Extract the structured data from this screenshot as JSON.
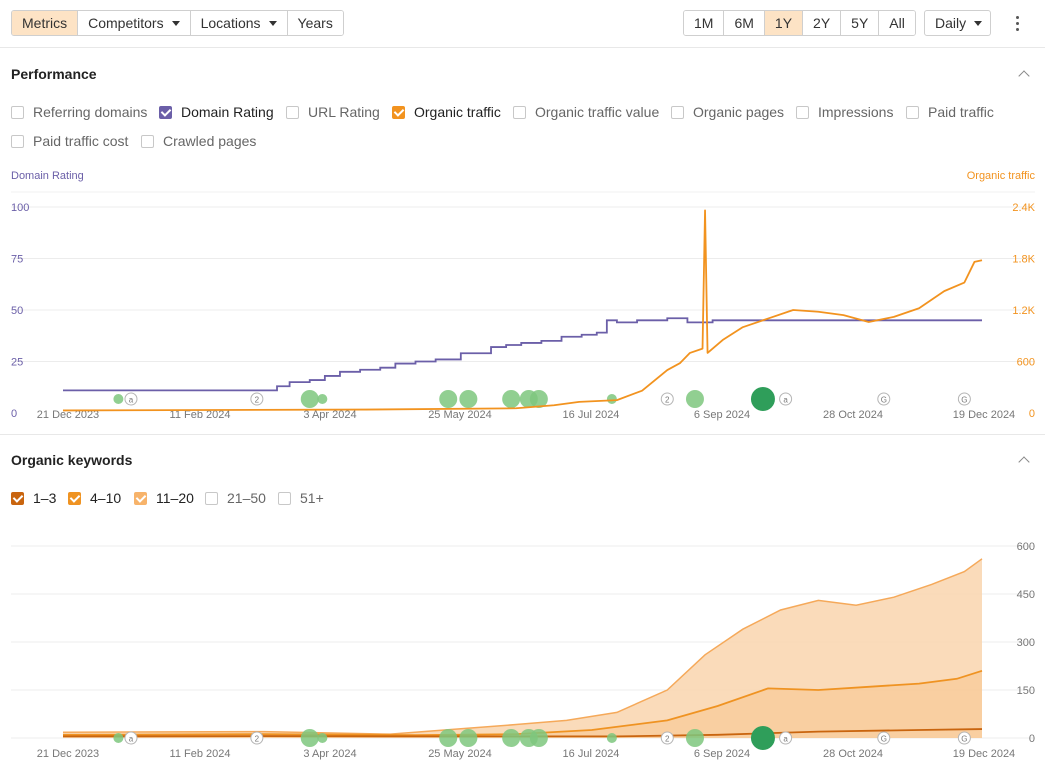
{
  "toolbar": {
    "tabs": [
      {
        "label": "Metrics",
        "active": true
      },
      {
        "label": "Competitors",
        "dropdown": true
      },
      {
        "label": "Locations",
        "dropdown": true
      },
      {
        "label": "Years"
      }
    ],
    "ranges": [
      {
        "label": "1M"
      },
      {
        "label": "6M"
      },
      {
        "label": "1Y",
        "active": true
      },
      {
        "label": "2Y"
      },
      {
        "label": "5Y"
      },
      {
        "label": "All"
      }
    ],
    "granularity": "Daily"
  },
  "performance": {
    "title": "Performance",
    "metrics": [
      {
        "label": "Referring domains",
        "checked": false
      },
      {
        "label": "Domain Rating",
        "checked": true,
        "color": "#6b5fa8"
      },
      {
        "label": "URL Rating",
        "checked": false
      },
      {
        "label": "Organic traffic",
        "checked": true,
        "color": "#f2931f"
      },
      {
        "label": "Organic traffic value",
        "checked": false
      },
      {
        "label": "Organic pages",
        "checked": false
      },
      {
        "label": "Impressions",
        "checked": false
      },
      {
        "label": "Paid traffic",
        "checked": false
      },
      {
        "label": "Paid traffic cost",
        "checked": false
      },
      {
        "label": "Crawled pages",
        "checked": false
      }
    ]
  },
  "keywords": {
    "title": "Organic keywords",
    "buckets": [
      {
        "label": "1–3",
        "checked": true,
        "color": "#c9650f"
      },
      {
        "label": "4–10",
        "checked": true,
        "color": "#ef9322"
      },
      {
        "label": "11–20",
        "checked": true,
        "color": "#f7b36a"
      },
      {
        "label": "21–50",
        "checked": false
      },
      {
        "label": "51+",
        "checked": false
      }
    ]
  },
  "colors": {
    "domain_rating": "#6b5fa8",
    "organic_traffic": "#f2931f",
    "kw_1_3": "#c9650f",
    "kw_4_10": "#ef9322",
    "kw_11_20_fill": "#fad7b2",
    "kw_11_20_line": "#f5a95a",
    "marker_green": "#7ec77e",
    "marker_dark": "#2f9e5a"
  },
  "chart_data": [
    {
      "type": "line",
      "left_axis_title": "Domain Rating",
      "right_axis_title": "Organic traffic",
      "x_ticks": [
        "21 Dec 2023",
        "11 Feb 2024",
        "3 Apr 2024",
        "25 May 2024",
        "16 Jul 2024",
        "6 Sep 2024",
        "28 Oct 2024",
        "19 Dec 2024"
      ],
      "left_ticks": [
        "100",
        "75",
        "50",
        "25",
        "0"
      ],
      "right_ticks": [
        "2.4K",
        "1.8K",
        "1.2K",
        "600",
        "0"
      ],
      "left_range": [
        0,
        100
      ],
      "right_range": [
        0,
        2400
      ],
      "x_range_days": [
        0,
        365
      ],
      "series": [
        {
          "name": "Domain Rating",
          "axis": "left",
          "points": [
            [
              0,
              11
            ],
            [
              82,
              11
            ],
            [
              85,
              13
            ],
            [
              90,
              15
            ],
            [
              98,
              16
            ],
            [
              104,
              18
            ],
            [
              110,
              20
            ],
            [
              118,
              21
            ],
            [
              126,
              22
            ],
            [
              132,
              24
            ],
            [
              140,
              25
            ],
            [
              148,
              26
            ],
            [
              158,
              29
            ],
            [
              164,
              29
            ],
            [
              170,
              32
            ],
            [
              176,
              33
            ],
            [
              182,
              34
            ],
            [
              190,
              35
            ],
            [
              198,
              37
            ],
            [
              206,
              38
            ],
            [
              212,
              39
            ],
            [
              216,
              45
            ],
            [
              220,
              44
            ],
            [
              228,
              45
            ],
            [
              240,
              46
            ],
            [
              248,
              44
            ],
            [
              258,
              45
            ],
            [
              272,
              45
            ],
            [
              300,
              45
            ],
            [
              330,
              45
            ],
            [
              365,
              45
            ]
          ]
        },
        {
          "name": "Organic traffic",
          "axis": "right",
          "points": [
            [
              0,
              30
            ],
            [
              60,
              35
            ],
            [
              120,
              40
            ],
            [
              180,
              55
            ],
            [
              195,
              90
            ],
            [
              205,
              130
            ],
            [
              220,
              150
            ],
            [
              230,
              260
            ],
            [
              240,
              500
            ],
            [
              245,
              580
            ],
            [
              249,
              700
            ],
            [
              254,
              750
            ],
            [
              255,
              2360
            ],
            [
              256,
              700
            ],
            [
              262,
              850
            ],
            [
              270,
              1000
            ],
            [
              280,
              1100
            ],
            [
              290,
              1200
            ],
            [
              300,
              1180
            ],
            [
              310,
              1140
            ],
            [
              320,
              1060
            ],
            [
              330,
              1120
            ],
            [
              340,
              1220
            ],
            [
              350,
              1420
            ],
            [
              358,
              1520
            ],
            [
              362,
              1760
            ],
            [
              365,
              1780
            ]
          ]
        }
      ]
    },
    {
      "type": "area",
      "x_ticks": [
        "21 Dec 2023",
        "11 Feb 2024",
        "3 Apr 2024",
        "25 May 2024",
        "16 Jul 2024",
        "6 Sep 2024",
        "28 Oct 2024",
        "19 Dec 2024"
      ],
      "right_ticks": [
        "600",
        "450",
        "300",
        "150",
        "0"
      ],
      "y_range": [
        0,
        600
      ],
      "x_range_days": [
        0,
        365
      ],
      "series": [
        {
          "name": "1–3",
          "points": [
            [
              0,
              5
            ],
            [
              80,
              6
            ],
            [
              150,
              5
            ],
            [
              220,
              5
            ],
            [
              260,
              10
            ],
            [
              300,
              20
            ],
            [
              340,
              25
            ],
            [
              365,
              28
            ]
          ]
        },
        {
          "name": "4–10",
          "points": [
            [
              0,
              10
            ],
            [
              80,
              12
            ],
            [
              140,
              9
            ],
            [
              180,
              12
            ],
            [
              210,
              25
            ],
            [
              240,
              55
            ],
            [
              260,
              100
            ],
            [
              280,
              155
            ],
            [
              300,
              150
            ],
            [
              320,
              160
            ],
            [
              340,
              170
            ],
            [
              355,
              185
            ],
            [
              365,
              210
            ]
          ]
        },
        {
          "name": "11–20",
          "points": [
            [
              0,
              18
            ],
            [
              80,
              20
            ],
            [
              130,
              12
            ],
            [
              160,
              30
            ],
            [
              180,
              42
            ],
            [
              200,
              55
            ],
            [
              220,
              80
            ],
            [
              240,
              150
            ],
            [
              255,
              260
            ],
            [
              270,
              340
            ],
            [
              285,
              400
            ],
            [
              300,
              430
            ],
            [
              315,
              415
            ],
            [
              330,
              440
            ],
            [
              345,
              480
            ],
            [
              358,
              520
            ],
            [
              365,
              560
            ]
          ]
        }
      ]
    }
  ],
  "markers": [
    {
      "day": 22,
      "size": "s",
      "kind": "green"
    },
    {
      "day": 27,
      "size": "s",
      "kind": "a"
    },
    {
      "day": 77,
      "size": "s",
      "kind": "2"
    },
    {
      "day": 98,
      "size": "l",
      "kind": "green"
    },
    {
      "day": 103,
      "size": "s",
      "kind": "green"
    },
    {
      "day": 153,
      "size": "l",
      "kind": "green"
    },
    {
      "day": 161,
      "size": "l",
      "kind": "green"
    },
    {
      "day": 178,
      "size": "l",
      "kind": "green"
    },
    {
      "day": 185,
      "size": "l",
      "kind": "green"
    },
    {
      "day": 189,
      "size": "l",
      "kind": "green"
    },
    {
      "day": 218,
      "size": "s",
      "kind": "green"
    },
    {
      "day": 240,
      "size": "s",
      "kind": "2"
    },
    {
      "day": 251,
      "size": "l",
      "kind": "green"
    },
    {
      "day": 278,
      "size": "xl",
      "kind": "dark"
    },
    {
      "day": 287,
      "size": "s",
      "kind": "a"
    },
    {
      "day": 326,
      "size": "s",
      "kind": "G"
    },
    {
      "day": 358,
      "size": "s",
      "kind": "G"
    }
  ]
}
